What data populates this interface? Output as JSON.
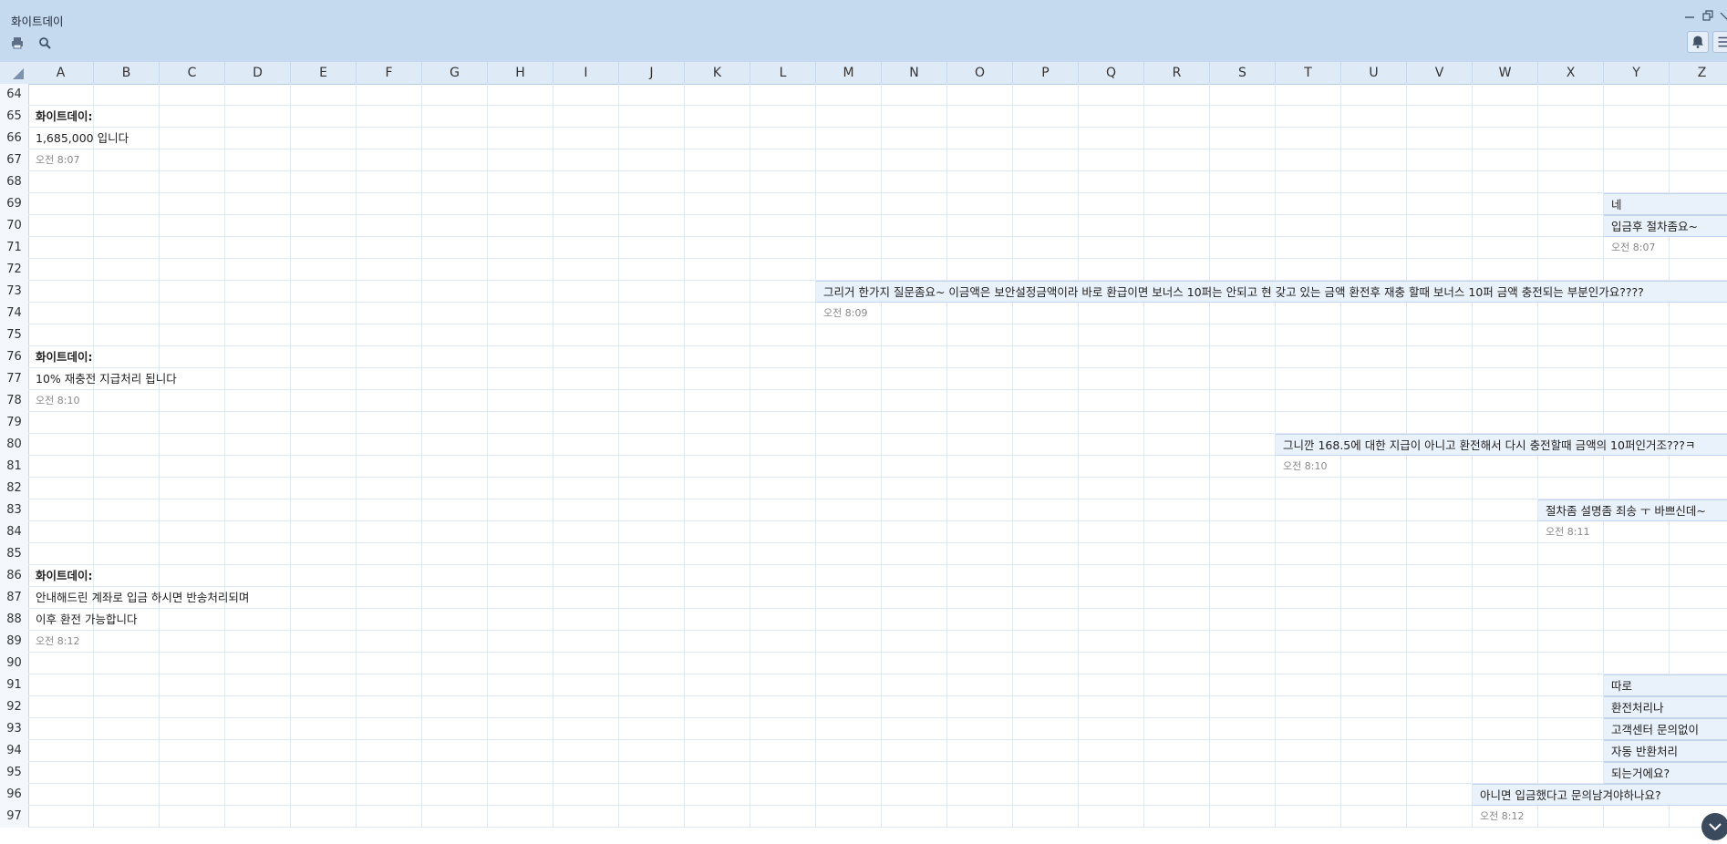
{
  "window": {
    "title": "화이트데이"
  },
  "toolbar": {
    "print_icon": "printer-icon",
    "search_icon": "search-icon"
  },
  "window_controls": {
    "minimize_icon": "minimize-icon",
    "restore_icon": "restore-icon",
    "bell_icon": "bell-icon",
    "menu_icon": "menu-icon"
  },
  "columns": [
    "A",
    "B",
    "C",
    "D",
    "E",
    "F",
    "G",
    "H",
    "I",
    "J",
    "K",
    "L",
    "M",
    "N",
    "O",
    "P",
    "Q",
    "R",
    "S",
    "T",
    "U",
    "V",
    "W",
    "X",
    "Y",
    "Z"
  ],
  "rows": [
    "64",
    "65",
    "66",
    "67",
    "68",
    "69",
    "70",
    "71",
    "72",
    "73",
    "74",
    "75",
    "76",
    "77",
    "78",
    "79",
    "80",
    "81",
    "82",
    "83",
    "84",
    "85",
    "86",
    "87",
    "88",
    "89",
    "90",
    "91",
    "92",
    "93",
    "94",
    "95",
    "96",
    "97"
  ],
  "messages": [
    {
      "row": "65",
      "col": "A",
      "text": "화이트데이:",
      "kind": "sender"
    },
    {
      "row": "66",
      "col": "A",
      "text": "1,685,000 입니다",
      "kind": "text"
    },
    {
      "row": "67",
      "col": "A",
      "text": "오전 8:07",
      "kind": "time"
    },
    {
      "row": "69",
      "col": "Y",
      "text": "네",
      "kind": "bubble"
    },
    {
      "row": "70",
      "col": "Y",
      "text": "입금후 절차좀요~",
      "kind": "bubble"
    },
    {
      "row": "71",
      "col": "Y",
      "text": "오전 8:07",
      "kind": "time"
    },
    {
      "row": "73",
      "col": "M",
      "text": "그리거 한가지 질문좀요~ 이금액은 보안설정금액이라 바로 환급이면 보너스 10퍼는 안되고 현 갖고 있는 금액 환전후 재충 할때 보너스 10퍼 금액 충전되는 부분인가요????",
      "kind": "bubble"
    },
    {
      "row": "74",
      "col": "M",
      "text": "오전 8:09",
      "kind": "time"
    },
    {
      "row": "76",
      "col": "A",
      "text": "화이트데이:",
      "kind": "sender"
    },
    {
      "row": "77",
      "col": "A",
      "text": "10% 재충전 지급처리 됩니다",
      "kind": "text"
    },
    {
      "row": "78",
      "col": "A",
      "text": "오전 8:10",
      "kind": "time"
    },
    {
      "row": "80",
      "col": "T",
      "text": "그니깐 168.5에 대한 지급이 아니고 환전해서 다시 충전할때 금액의 10퍼인거조???ㅋ",
      "kind": "bubble"
    },
    {
      "row": "81",
      "col": "T",
      "text": "오전 8:10",
      "kind": "time"
    },
    {
      "row": "83",
      "col": "X",
      "text": "절차좀 설명좀 죄송 ㅜ 바쁘신데~",
      "kind": "bubble"
    },
    {
      "row": "84",
      "col": "X",
      "text": "오전 8:11",
      "kind": "time"
    },
    {
      "row": "86",
      "col": "A",
      "text": "화이트데이:",
      "kind": "sender"
    },
    {
      "row": "87",
      "col": "A",
      "text": "안내해드린 계좌로 입금 하시면 반송처리되며",
      "kind": "text"
    },
    {
      "row": "88",
      "col": "A",
      "text": "이후 환전 가능합니다",
      "kind": "text"
    },
    {
      "row": "89",
      "col": "A",
      "text": "오전 8:12",
      "kind": "time"
    },
    {
      "row": "91",
      "col": "Y",
      "text": "따로",
      "kind": "bubble"
    },
    {
      "row": "92",
      "col": "Y",
      "text": "환전처리나",
      "kind": "bubble"
    },
    {
      "row": "93",
      "col": "Y",
      "text": "고객센터 문의없이",
      "kind": "bubble"
    },
    {
      "row": "94",
      "col": "Y",
      "text": "자동 반환처리",
      "kind": "bubble"
    },
    {
      "row": "95",
      "col": "Y",
      "text": "되는거에요?",
      "kind": "bubble"
    },
    {
      "row": "96",
      "col": "W",
      "text": "아니면 입금했다고 문의남겨야하나요?",
      "kind": "bubble"
    },
    {
      "row": "97",
      "col": "W",
      "text": "오전 8:12",
      "kind": "time"
    }
  ]
}
